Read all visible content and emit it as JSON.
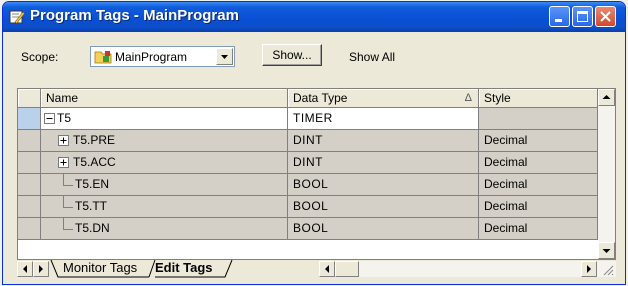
{
  "window": {
    "title": "Program Tags - MainProgram",
    "title_icon": "edit-tags-icon",
    "controls": [
      "minimize-icon",
      "maximize-icon",
      "close-icon"
    ]
  },
  "toolbar": {
    "scope_label": "Scope:",
    "scope_value": "MainProgram",
    "show_label": "Show...",
    "show_filter": "Show All"
  },
  "grid": {
    "columns": [
      {
        "label": "Name"
      },
      {
        "label": "Data Type",
        "sort_indicator": "Δ"
      },
      {
        "label": "Style"
      }
    ],
    "rows": [
      {
        "expander": "minus",
        "name": "T5",
        "data_type": "TIMER",
        "style": "",
        "selected": true
      },
      {
        "expander": "plus",
        "name": "T5.PRE",
        "data_type": "DINT",
        "style": "Decimal"
      },
      {
        "expander": "plus",
        "name": "T5.ACC",
        "data_type": "DINT",
        "style": "Decimal"
      },
      {
        "expander": "none",
        "name": "T5.EN",
        "data_type": "BOOL",
        "style": "Decimal"
      },
      {
        "expander": "none",
        "name": "T5.TT",
        "data_type": "BOOL",
        "style": "Decimal"
      },
      {
        "expander": "none",
        "name": "T5.DN",
        "data_type": "BOOL",
        "style": "Decimal"
      }
    ]
  },
  "tabs": [
    {
      "label": "Monitor Tags",
      "active": false
    },
    {
      "label": "Edit Tags",
      "active": true
    }
  ],
  "colors": {
    "title_bar": "#0a4fd3",
    "window_face": "#ece9d8",
    "cell_face": "#d4d0c8",
    "close_button": "#d4482a"
  }
}
